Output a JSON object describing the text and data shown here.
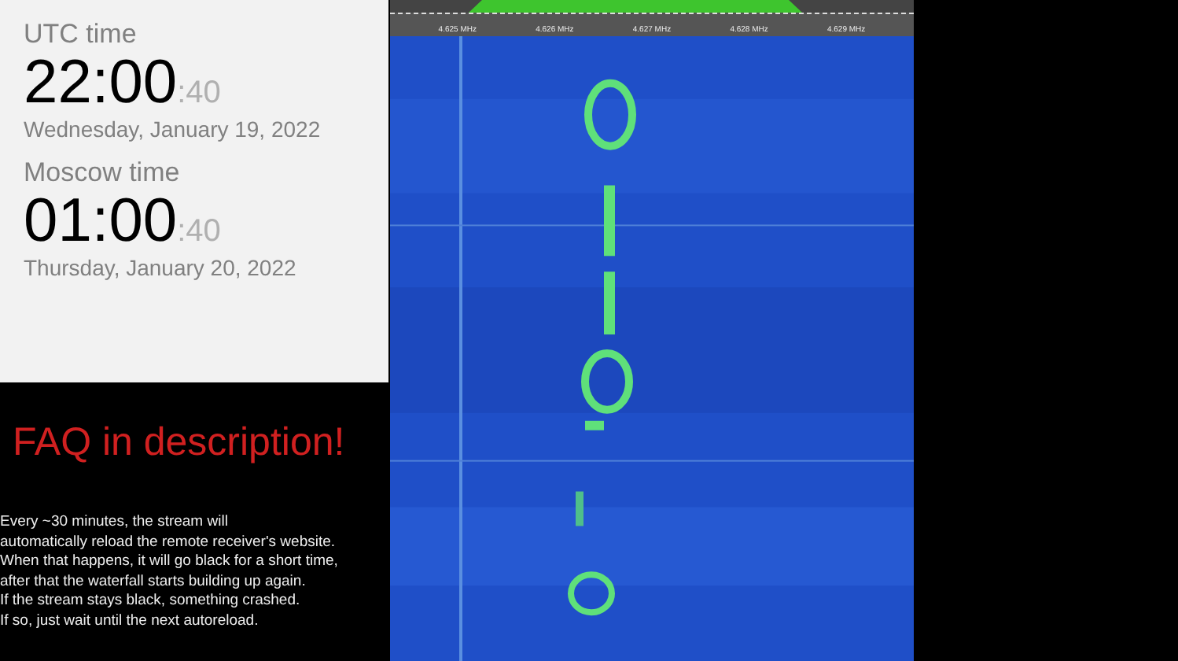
{
  "clocks": [
    {
      "label": "UTC time",
      "time": "22:00",
      "seconds": ":40",
      "date": "Wednesday, January 19, 2022"
    },
    {
      "label": "Moscow time",
      "time": "01:00",
      "seconds": ":40",
      "date": "Thursday, January 20, 2022"
    }
  ],
  "faq": "FAQ in description!",
  "notice": [
    "Every ~30 minutes, the stream will",
    "automatically reload the remote receiver's website.",
    "When that happens, it will go black for a short time,",
    "after that the waterfall starts building up again.",
    "If the stream stays black, something crashed.",
    "If so, just wait until the next autoreload."
  ],
  "waterfall": {
    "scale_labels": [
      "4.625 MHz",
      "4.626 MHz",
      "4.627 MHz",
      "4.628 MHz",
      "4.629 MHz"
    ],
    "picture": {
      "kind": "picture"
    }
  }
}
